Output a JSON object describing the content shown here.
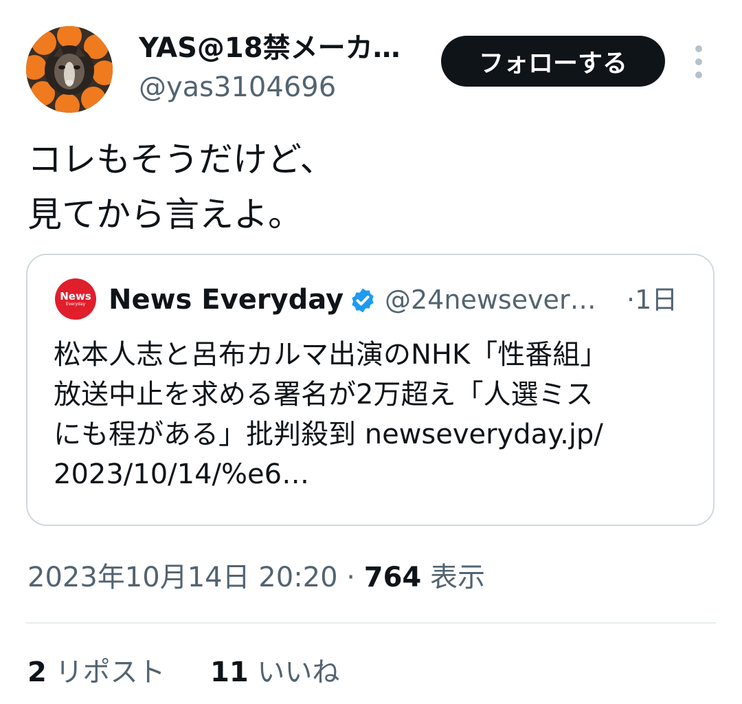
{
  "author": {
    "display_name": "YAS@18禁メーカ…",
    "handle": "@yas3104696",
    "avatar_icon": "cat-avatar-orange-flower-frame"
  },
  "follow_button": {
    "label": "フォローする"
  },
  "more_menu": {
    "icon": "more-vertical-icon"
  },
  "tweet": {
    "text": "コレもそうだけど、\n見てから言えよ。"
  },
  "quote": {
    "avatar_text_main": "News",
    "avatar_text_sub": "Everyday",
    "display_name": "News Everyday",
    "verified": true,
    "handle": "@24newsever…",
    "time": "·1日",
    "text": "松本人志と呂布カルマ出演のNHK「性番組」\n放送中止を求める署名が2万超え「人選ミス\nにも程がある」批判殺到 newseveryday.jp/\n2023/10/14/%e6…"
  },
  "meta": {
    "timestamp": "2023年10月14日 20:20",
    "separator": " · ",
    "views_count": "764",
    "views_label": " 表示"
  },
  "stats": {
    "reposts_count": "2",
    "reposts_label": " リポスト",
    "likes_count": "11",
    "likes_label": " いいね"
  },
  "colors": {
    "text": "#0f1419",
    "secondary": "#536471",
    "border": "#cfd9de",
    "verified_blue": "#1d9bf0",
    "news_red": "#e01e2c"
  }
}
